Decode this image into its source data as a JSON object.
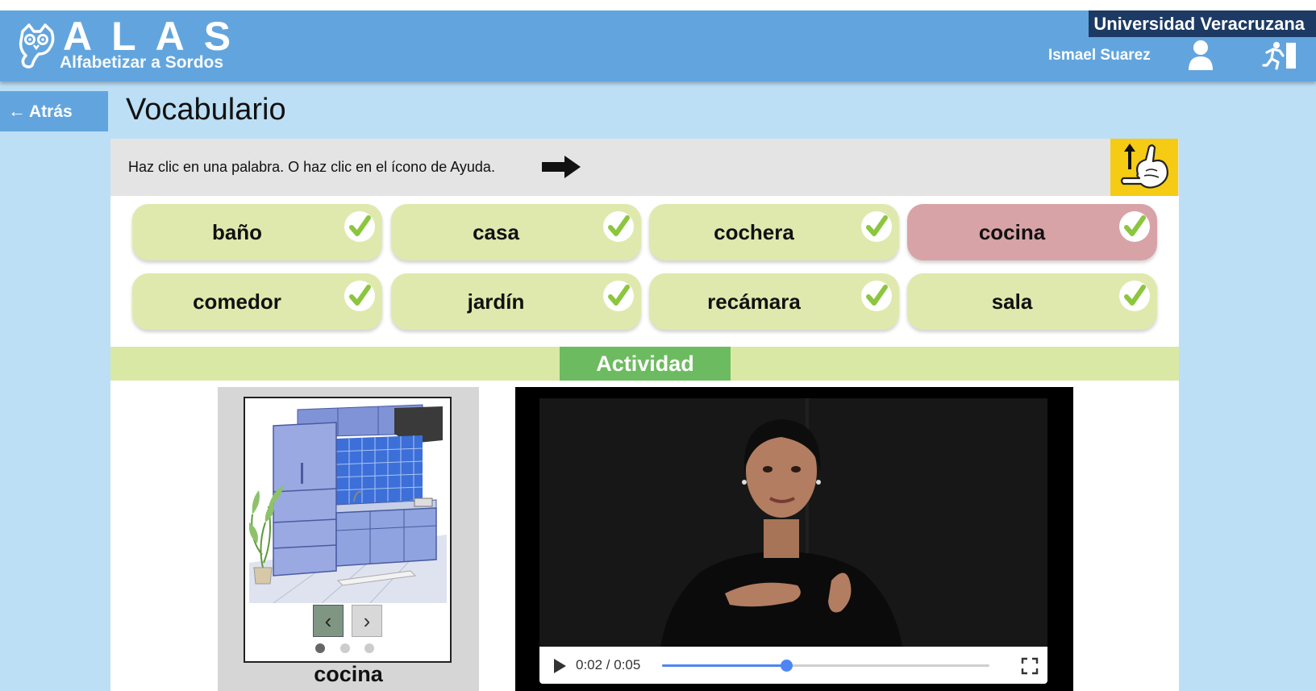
{
  "header": {
    "logo_title": "ALAS",
    "logo_subtitle": "Alfabetizar a Sordos",
    "institution": "Universidad Veracruzana",
    "user_name": "Ismael Suarez"
  },
  "nav": {
    "back_label": "Atrás",
    "page_title": "Vocabulario"
  },
  "instructions": {
    "text": "Haz clic en una palabra. O haz clic en el ícono de Ayuda."
  },
  "words": [
    {
      "label": "baño",
      "completed": true,
      "active": false
    },
    {
      "label": "casa",
      "completed": true,
      "active": false
    },
    {
      "label": "cochera",
      "completed": true,
      "active": false
    },
    {
      "label": "cocina",
      "completed": true,
      "active": true
    },
    {
      "label": "comedor",
      "completed": true,
      "active": false
    },
    {
      "label": "jardín",
      "completed": true,
      "active": false
    },
    {
      "label": "recámara",
      "completed": true,
      "active": false
    },
    {
      "label": "sala",
      "completed": true,
      "active": false
    }
  ],
  "activity": {
    "tab_label": "Actividad"
  },
  "image_card": {
    "caption": "cocina",
    "slide_count": 3,
    "current_slide": 1,
    "prev_icon": "chevron-left-icon",
    "next_icon": "chevron-right-icon"
  },
  "video": {
    "time_display": "0:02 / 0:05",
    "progress": 0.38
  },
  "colors": {
    "header": "#62a5de",
    "institution_box": "#1c3a63",
    "page_background": "#bcdff5",
    "word_card": "#dfe9ad",
    "word_card_active": "#d8a3a7",
    "check": "#8cc63f",
    "activity_band": "#d9e8a4",
    "activity_tab": "#6dbb60",
    "help_button": "#f5cb13",
    "seek_accent": "#4d86f3"
  }
}
